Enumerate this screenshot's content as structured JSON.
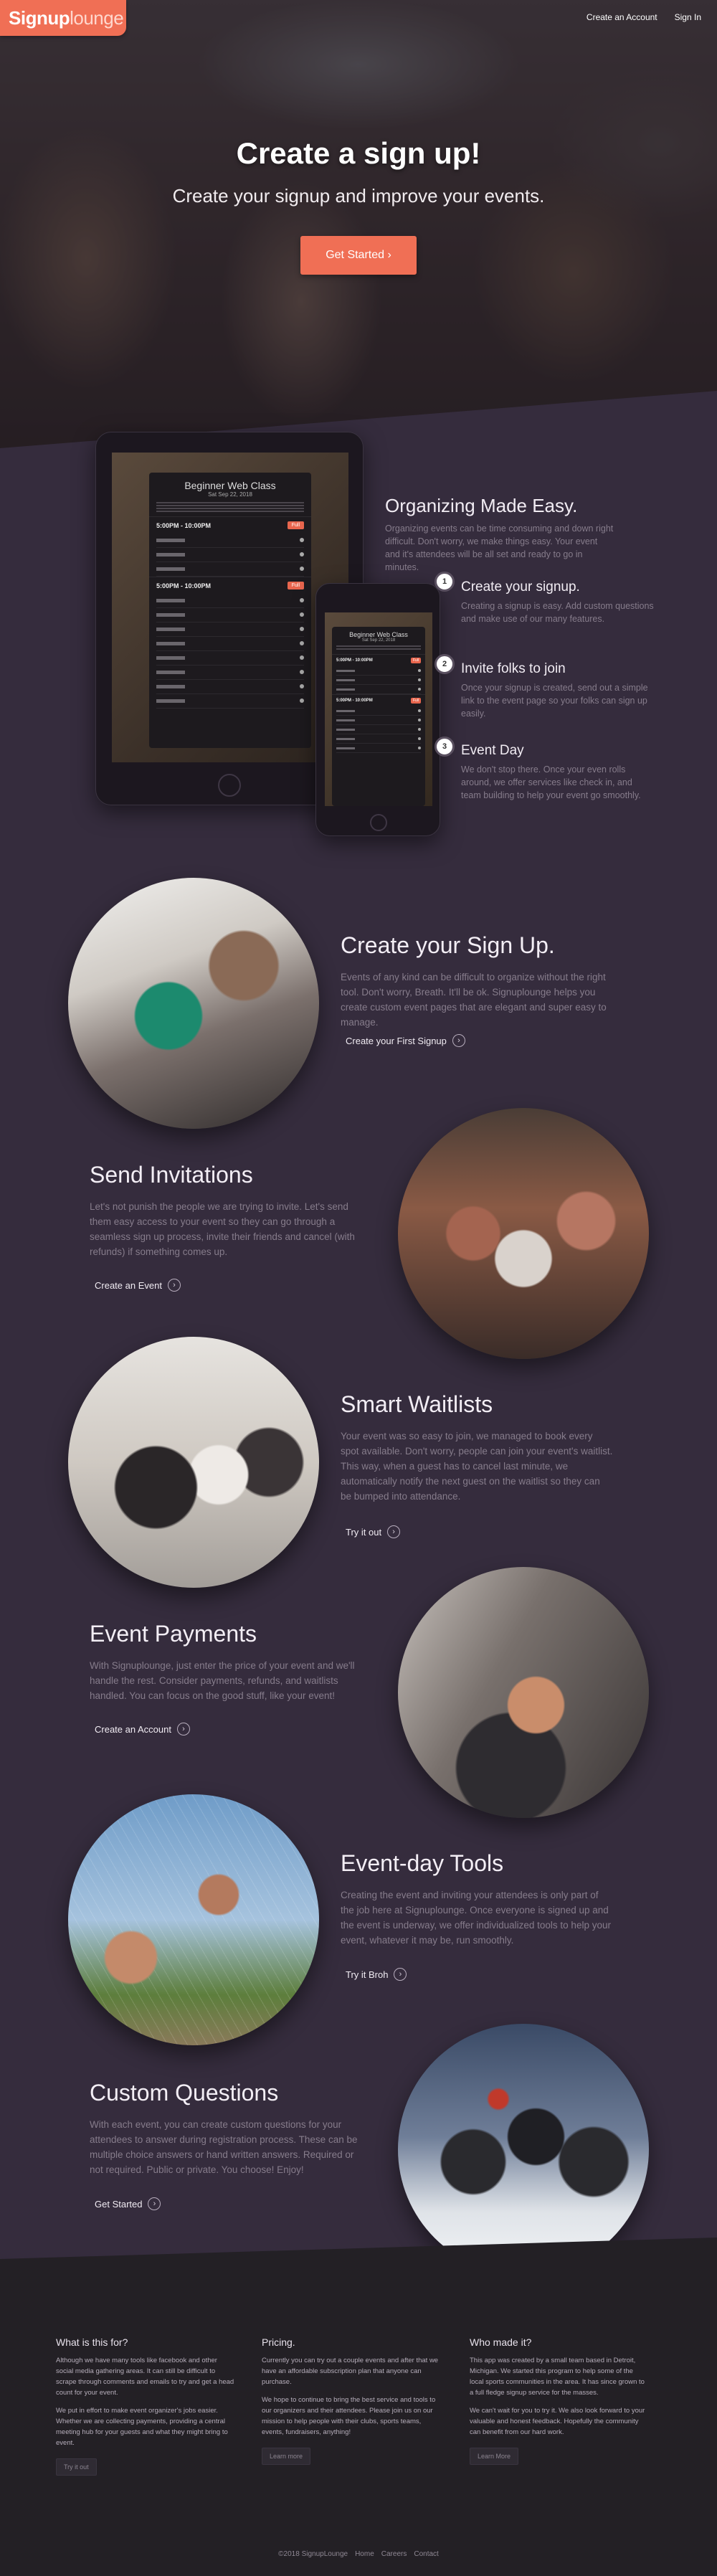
{
  "header": {
    "logo_bold": "Signup",
    "logo_light": "lounge",
    "nav": [
      "Create an Account",
      "Sign In"
    ]
  },
  "hero": {
    "title": "Create a sign up!",
    "subtitle": "Create your signup and improve your events.",
    "cta": "Get Started ›"
  },
  "mockup": {
    "event_title": "Beginner Web Class",
    "event_date": "Sat Sep 22, 2018",
    "slots": [
      "5:00PM - 10:00PM",
      "5:00PM - 10:00PM"
    ],
    "slot_badge": "Full"
  },
  "organizing": {
    "title": "Organizing Made Easy.",
    "description": "Organizing events can be time consuming and down right difficult. Don't worry, we make things easy. Your event and it's attendees will be all set and ready to go in minutes.",
    "steps": [
      {
        "num": "1",
        "title": "Create your signup.",
        "desc": "Creating a signup is easy. Add custom questions and make use of our many features."
      },
      {
        "num": "2",
        "title": "Invite folks to join",
        "desc": "Once your signup is created, send out a simple link to the event page so your folks can sign up easily."
      },
      {
        "num": "3",
        "title": "Event Day",
        "desc": "We don't stop there. Once your even rolls around, we offer services like check in, and team building to help your event go smoothly."
      }
    ]
  },
  "features": [
    {
      "title": "Create your Sign Up.",
      "desc": "Events of any kind can be difficult to organize without the right tool. Don't worry, Breath. It'll be ok. Signuplounge helps you create custom event pages that are elegant and super easy to manage.",
      "link": "Create your First Signup"
    },
    {
      "title": "Send Invitations",
      "desc": "Let's not punish the people we are trying to invite. Let's send them easy access to your event so they can go through a seamless sign up process, invite their friends and cancel (with refunds) if something comes up.",
      "link": "Create an Event"
    },
    {
      "title": "Smart Waitlists",
      "desc": "Your event was so easy to join, we managed to book every spot available. Don't worry, people can join your event's waitlist. This way, when a guest has to cancel last minute, we automatically notify the next guest on the waitlist so they can be bumped into attendance.",
      "link": "Try it out"
    },
    {
      "title": "Event Payments",
      "desc": "With Signuplounge, just enter the price of your event and we'll handle the rest. Consider payments, refunds, and waitlists handled. You can focus on the good stuff, like your event!",
      "link": "Create an Account"
    },
    {
      "title": "Event-day Tools",
      "desc": "Creating the event and inviting your attendees is only part of the job here at Signuplounge. Once everyone is signed up and the event is underway, we offer individualized tools to help your event, whatever it may be, run smoothly.",
      "link": "Try it Broh"
    },
    {
      "title": "Custom Questions",
      "desc": "With each event, you can create custom questions for your attendees to answer during registration process. These can be multiple choice answers or hand written answers. Required or not required. Public or private. You choose! Enjoy!",
      "link": "Get Started"
    }
  ],
  "footer": {
    "cols": [
      {
        "head": "What is this for?",
        "p1": "Although we have many tools like facebook and other social media gathering areas. It can still be difficult to scrape through comments and emails to try and get a head count for your event.",
        "p2": "We put in effort to make event organizer's jobs easier. Whether we are collecting payments, providing a central meeting hub for your guests and what they might bring to event.",
        "btn": "Try it out"
      },
      {
        "head": "Pricing.",
        "p1": "Currently you can try out a couple events and after that we have an affordable subscription plan that anyone can purchase.",
        "p2": "We hope to continue to bring the best service and tools to our organizers and their attendees. Please join us on our mission to help people with their clubs, sports teams, events, fundraisers, anything!",
        "btn": "Learn more"
      },
      {
        "head": "Who made it?",
        "p1": "This app was created by a small team based in Detroit, Michigan. We started this program to help some of the local sports communities in the area. It has since grown to a full fledge signup service for the masses.",
        "p2": "We can't wait for you to try it. We also look forward to your valuable and honest feedback. Hopefully the community can benefit from our hard work.",
        "btn": "Learn More"
      }
    ],
    "copyright": "©2018 SignupLounge",
    "links": [
      "Home",
      "Careers",
      "Contact"
    ]
  }
}
